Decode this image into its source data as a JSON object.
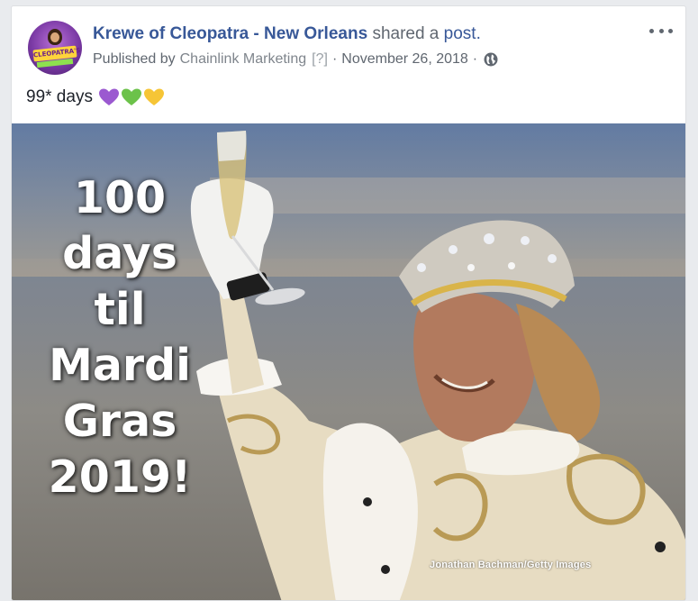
{
  "post": {
    "page_name": "Krewe of Cleopatra - New Orleans",
    "shared_text": "shared a",
    "post_link": "post.",
    "published_by_label": "Published by",
    "publisher": "Chainlink Marketing",
    "publisher_help": "[?]",
    "separator": "·",
    "date": "November 26, 2018",
    "privacy_icon": "globe-icon",
    "more_icon": "more-options-icon",
    "message": "99* days",
    "hearts": [
      {
        "icon": "purple-heart-icon",
        "color": "#9b59d0"
      },
      {
        "icon": "green-heart-icon",
        "color": "#6cc24a"
      },
      {
        "icon": "yellow-heart-icon",
        "color": "#f6c536"
      }
    ],
    "avatar_text": "CLEOPATRA'S",
    "photo": {
      "overlay_lines": "100\ndays\ntil\nMardi\nGras\n2019!",
      "credit": "Jonathan Bachman/Getty Images"
    }
  },
  "colors": {
    "link": "#385898",
    "text": "#1d2129",
    "meta": "#606770",
    "background": "#e9ebee"
  }
}
